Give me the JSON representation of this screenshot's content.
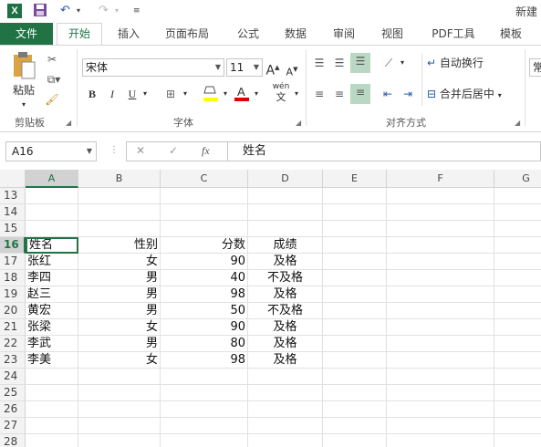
{
  "title_bar": {
    "app_icon": "X",
    "title": "新建"
  },
  "ribbon_tabs": [
    "文件",
    "开始",
    "插入",
    "页面布局",
    "公式",
    "数据",
    "审阅",
    "视图",
    "PDF工具",
    "模板"
  ],
  "ribbon": {
    "paste_label": "粘贴",
    "clipboard_label": "剪贴板",
    "font_name": "宋体",
    "font_size": "11",
    "font_group_label": "字体",
    "bold": "B",
    "italic": "I",
    "underline": "U",
    "phonetic": "wén",
    "wrap_text": "自动换行",
    "merge_center": "合并后居中",
    "alignment_label": "对齐方式",
    "next_group_partial": "常"
  },
  "formula_bar": {
    "name_box": "A16",
    "fx": "fx",
    "formula": "姓名"
  },
  "sheet": {
    "columns": [
      "A",
      "B",
      "C",
      "D",
      "E",
      "F",
      "G"
    ],
    "row_numbers": [
      "13",
      "14",
      "15",
      "16",
      "17",
      "18",
      "19",
      "20",
      "21",
      "22",
      "23",
      "24",
      "25",
      "26",
      "27",
      "28"
    ],
    "rows": [
      [
        "",
        "",
        "",
        ""
      ],
      [
        "",
        "",
        "",
        ""
      ],
      [
        "",
        "",
        "",
        ""
      ],
      [
        "姓名",
        "性别",
        "分数",
        "成绩"
      ],
      [
        "张红",
        "女",
        "90",
        "及格"
      ],
      [
        "李四",
        "男",
        "40",
        "不及格"
      ],
      [
        "赵三",
        "男",
        "98",
        "及格"
      ],
      [
        "黄宏",
        "男",
        "50",
        "不及格"
      ],
      [
        "张梁",
        "女",
        "90",
        "及格"
      ],
      [
        "李武",
        "男",
        "80",
        "及格"
      ],
      [
        "李美",
        "女",
        "98",
        "及格"
      ],
      [
        "",
        "",
        "",
        ""
      ],
      [
        "",
        "",
        "",
        ""
      ],
      [
        "",
        "",
        "",
        ""
      ],
      [
        "",
        "",
        "",
        ""
      ],
      [
        "",
        "",
        "",
        ""
      ]
    ]
  },
  "colors": {
    "accent": "#217346",
    "highlight": "#b9d8c4",
    "font_color_bar": "#e00000",
    "fill_color_bar": "#ffff00"
  }
}
